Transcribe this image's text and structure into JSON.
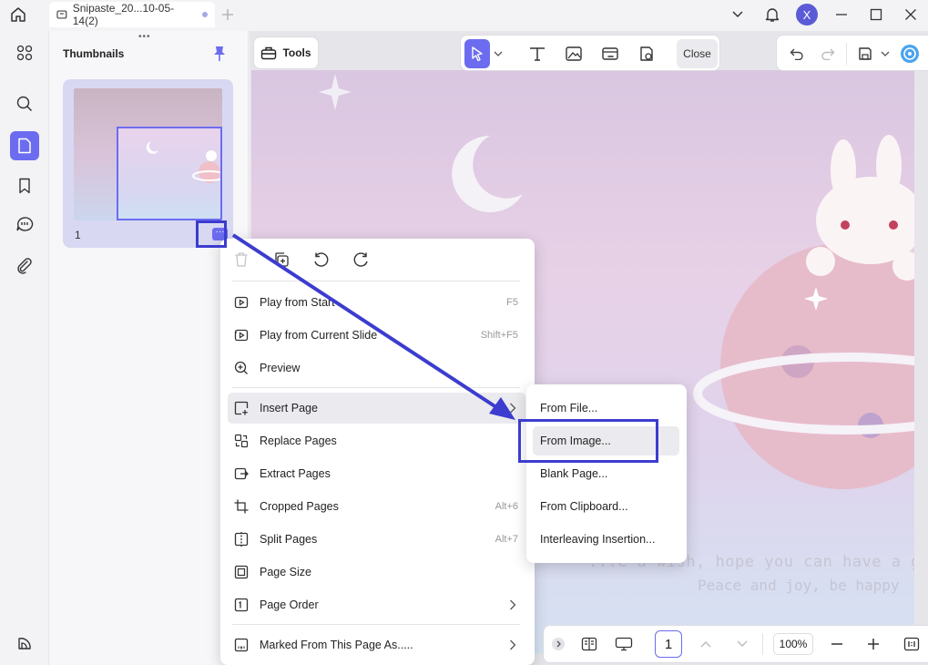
{
  "titlebar": {
    "tab_title": "Snipaste_20...10-05-14(2)",
    "avatar_letter": "X"
  },
  "thumbnails": {
    "title": "Thumbnails",
    "page_number": "1",
    "more_glyph": "···"
  },
  "toolbar": {
    "tools_label": "Tools",
    "close_label": "Close"
  },
  "context_menu": {
    "items": [
      {
        "label": "Play from Start",
        "shortcut": "F5",
        "icon": "play-icon"
      },
      {
        "label": "Play from Current Slide",
        "shortcut": "Shift+F5",
        "icon": "play-current-icon"
      },
      {
        "label": "Preview",
        "shortcut": "",
        "icon": "preview-icon"
      },
      {
        "label": "Insert Page",
        "shortcut": "",
        "icon": "insert-page-icon"
      },
      {
        "label": "Replace Pages",
        "shortcut": "",
        "icon": "replace-pages-icon"
      },
      {
        "label": "Extract Pages",
        "shortcut": "",
        "icon": "extract-pages-icon"
      },
      {
        "label": "Cropped Pages",
        "shortcut": "Alt+6",
        "icon": "crop-icon"
      },
      {
        "label": "Split Pages",
        "shortcut": "Alt+7",
        "icon": "split-icon"
      },
      {
        "label": "Page Size",
        "shortcut": "",
        "icon": "page-size-icon"
      },
      {
        "label": "Page Order",
        "shortcut": "",
        "icon": "page-order-icon"
      },
      {
        "label": "Marked From This Page As.....",
        "shortcut": "",
        "icon": "mark-icon"
      }
    ]
  },
  "insert_submenu": {
    "items": [
      {
        "label": "From File..."
      },
      {
        "label": "From Image..."
      },
      {
        "label": "Blank Page..."
      },
      {
        "label": "From Clipboard..."
      },
      {
        "label": "Interleaving Insertion..."
      }
    ]
  },
  "page_content": {
    "line1": "...e a wish, hope you can have a g",
    "line2": "Peace and joy, be happy"
  },
  "bottombar": {
    "current_page": "1",
    "zoom": "100%"
  },
  "colors": {
    "accent": "#6c6cf0",
    "annotation": "#3c3ccf"
  }
}
